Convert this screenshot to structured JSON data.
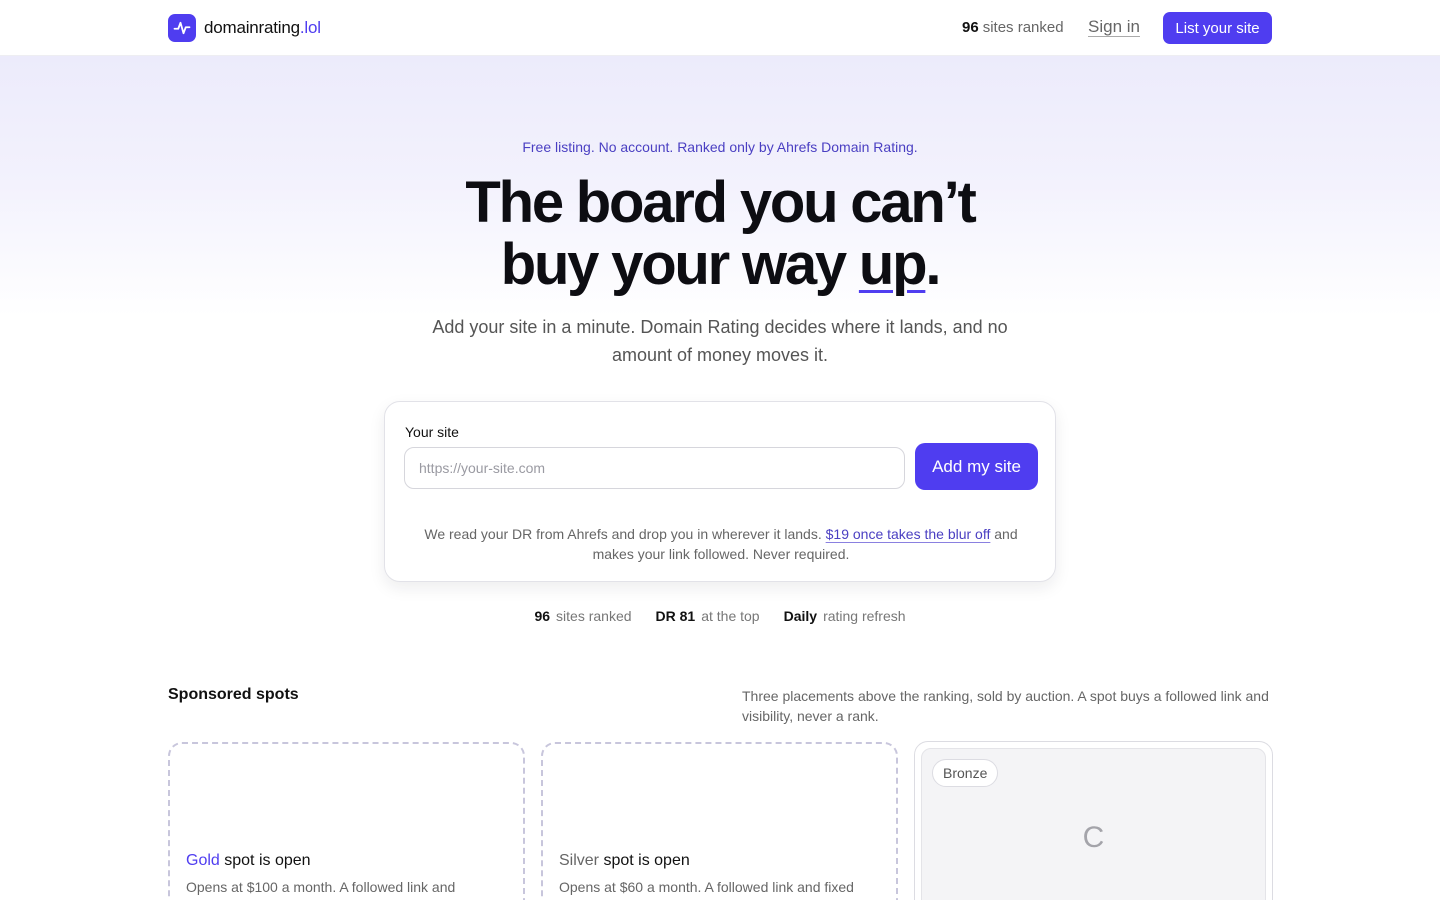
{
  "header": {
    "logo_name": "domainrating",
    "logo_tld": ".lol",
    "count": "96",
    "count_label": "sites ranked",
    "signin": "Sign in",
    "cta": "List your site"
  },
  "hero": {
    "eyebrow": "Free listing. No account. Ranked only by Ahrefs Domain Rating.",
    "headline_line1": "The board you can’t",
    "headline_line2a": "buy your way ",
    "headline_line2b": "up",
    "headline_line2c": ".",
    "subhead": "Add your site in a minute. Domain Rating decides where it lands, and no amount of money moves it."
  },
  "form": {
    "label": "Your site",
    "placeholder": "https://your-site.com",
    "value": "",
    "button": "Add my site",
    "note_pre": "We read your DR from Ahrefs and drop you in wherever it lands. ",
    "note_link": "$19 once takes the blur off",
    "note_post": " and makes your link followed. Never required."
  },
  "stats": [
    {
      "value": "96",
      "label": "sites ranked"
    },
    {
      "value": "DR 81",
      "label": "at the top"
    },
    {
      "value": "Daily",
      "label": "rating refresh"
    }
  ],
  "sponsored": {
    "title": "Sponsored spots",
    "description": "Three placements above the ranking, sold by auction. A spot buys a followed link and visibility, never a rank.",
    "slots": [
      {
        "tier": "Gold",
        "status": "spot is open",
        "body": "Opens at $100 a month. A followed link and"
      },
      {
        "tier": "Silver",
        "status": "spot is open",
        "body": "Opens at $60 a month. A followed link and fixed"
      },
      {
        "tier": "Bronze",
        "initial": "C"
      }
    ]
  },
  "colors": {
    "accent": "#4f3df0"
  }
}
